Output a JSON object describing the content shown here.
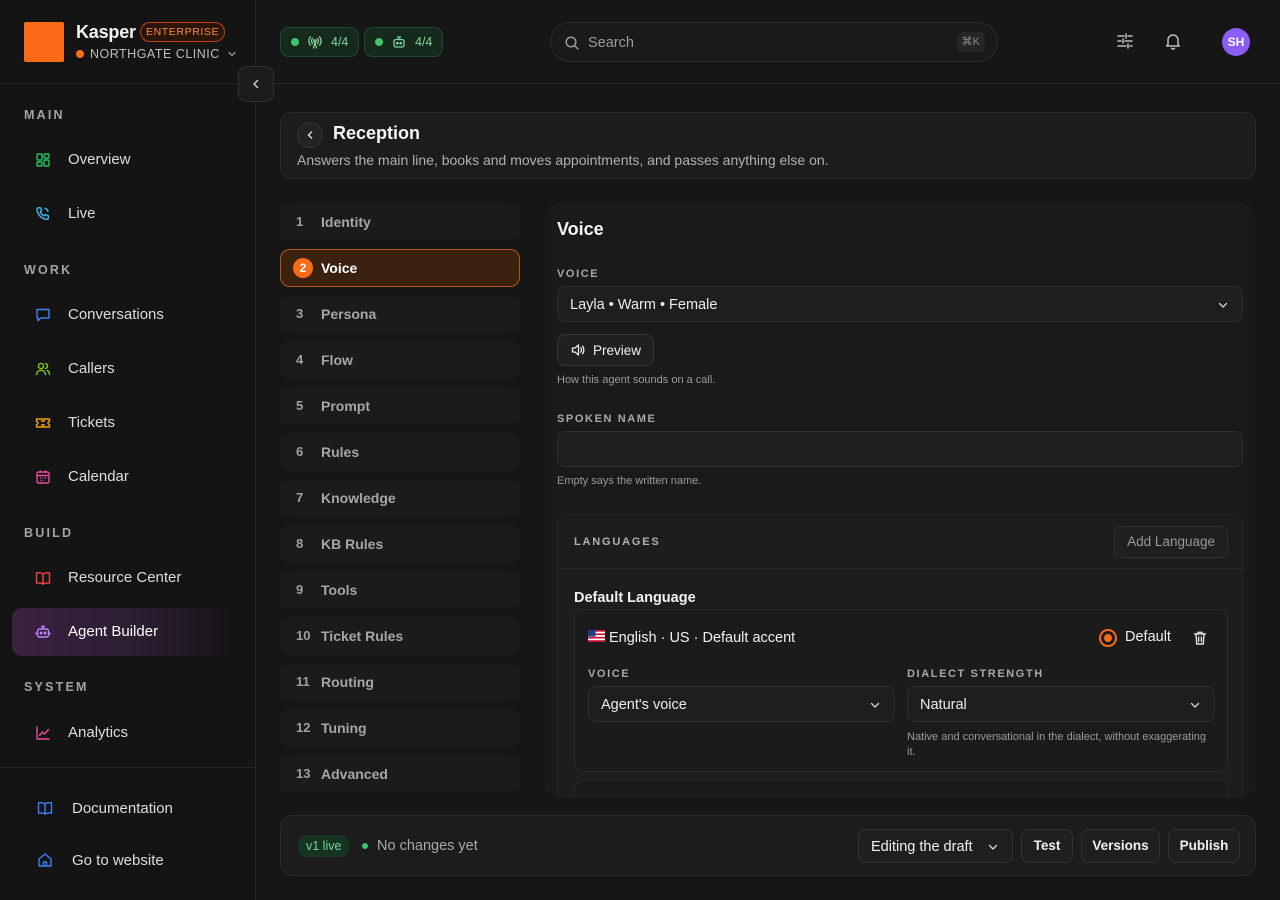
{
  "brand": {
    "name": "Kasper",
    "badge": "ENTERPRISE",
    "org": "NORTHGATE CLINIC",
    "logo_color": "#fb6a16"
  },
  "status": [
    {
      "icon": "broadcast-icon",
      "value": "4/4"
    },
    {
      "icon": "robot-icon",
      "value": "4/4"
    }
  ],
  "search": {
    "placeholder": "Search",
    "shortcut": "⌘K"
  },
  "user": {
    "initials": "SH",
    "avatar_color": "#8b5cf6"
  },
  "nav": {
    "sections": [
      "MAIN",
      "WORK",
      "BUILD",
      "SYSTEM"
    ],
    "items": [
      {
        "label": "Overview",
        "icon": "grid-icon",
        "color": "#22c55e"
      },
      {
        "label": "Live",
        "icon": "phone-icon",
        "color": "#38bdf8"
      },
      {
        "label": "Conversations",
        "icon": "chat-icon",
        "color": "#3b82f6"
      },
      {
        "label": "Callers",
        "icon": "users-icon",
        "color": "#84cc16"
      },
      {
        "label": "Tickets",
        "icon": "ticket-icon",
        "color": "#f59e0b"
      },
      {
        "label": "Calendar",
        "icon": "calendar-icon",
        "color": "#ec4899"
      },
      {
        "label": "Resource Center",
        "icon": "book-icon",
        "color": "#ef4444"
      },
      {
        "label": "Agent Builder",
        "icon": "bot-icon",
        "color": "#c084fc",
        "active": true
      },
      {
        "label": "Analytics",
        "icon": "chart-icon",
        "color": "#ec4899"
      }
    ],
    "footer": [
      {
        "label": "Documentation",
        "icon": "book-open-icon",
        "color": "#3b82f6"
      },
      {
        "label": "Go to website",
        "icon": "home-icon",
        "color": "#3b82f6"
      }
    ]
  },
  "header": {
    "title": "Reception",
    "subtitle": "Answers the main line, books and moves appointments, and passes anything else on."
  },
  "steps": [
    {
      "num": "1",
      "label": "Identity"
    },
    {
      "num": "2",
      "label": "Voice",
      "active": true
    },
    {
      "num": "3",
      "label": "Persona"
    },
    {
      "num": "4",
      "label": "Flow"
    },
    {
      "num": "5",
      "label": "Prompt"
    },
    {
      "num": "6",
      "label": "Rules"
    },
    {
      "num": "7",
      "label": "Knowledge"
    },
    {
      "num": "8",
      "label": "KB Rules"
    },
    {
      "num": "9",
      "label": "Tools"
    },
    {
      "num": "10",
      "label": "Ticket Rules"
    },
    {
      "num": "11",
      "label": "Routing"
    },
    {
      "num": "12",
      "label": "Tuning"
    },
    {
      "num": "13",
      "label": "Advanced"
    }
  ],
  "voice_panel": {
    "title": "Voice",
    "voice_label": "VOICE",
    "voice_value": "Layla • Warm • Female",
    "preview_label": "Preview",
    "voice_hint": "How this agent sounds on a call.",
    "spoken_name_label": "SPOKEN NAME",
    "spoken_name_value": "",
    "spoken_name_hint": "Empty says the written name.",
    "languages": {
      "heading": "LANGUAGES",
      "add_label": "Add Language",
      "default_title": "Default Language",
      "default_item": {
        "flag": "🇺🇸",
        "name": "English · US · Default accent",
        "default_label": "Default",
        "voice_label": "VOICE",
        "voice_value": "Agent's voice",
        "dialect_label": "DIALECT STRENGTH",
        "dialect_value": "Natural",
        "dialect_hint": "Native and conversational in the dialect, without exaggerating it."
      }
    }
  },
  "footer": {
    "version_badge": "v1 live",
    "status": "No changes yet",
    "mode": "Editing the draft",
    "test_label": "Test",
    "versions_label": "Versions",
    "publish_label": "Publish"
  }
}
